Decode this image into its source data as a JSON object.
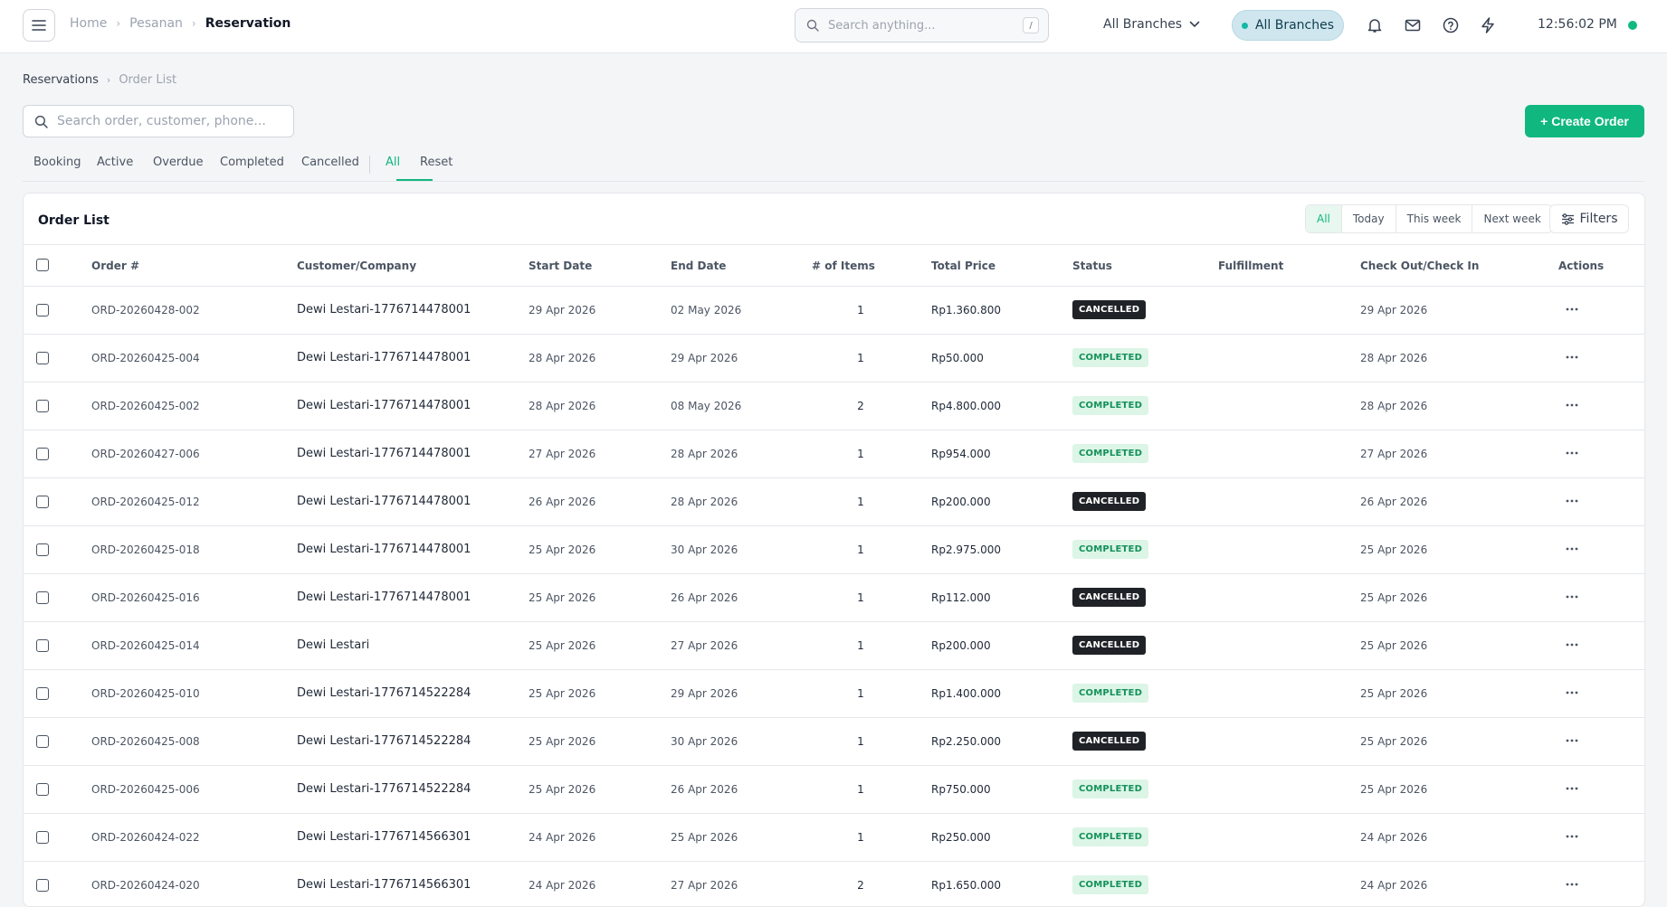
{
  "topbar": {
    "breadcrumb": [
      "Home",
      "Pesanan",
      "Reservation"
    ],
    "search_placeholder": "Search anything...",
    "search_shortcut": "/",
    "branch_select": "All Branches",
    "branch_pill": "All Branches",
    "time": "12:56:02 PM"
  },
  "page": {
    "breadcrumb": [
      "Reservations",
      "Order List"
    ],
    "search_placeholder": "Search order, customer, phone...",
    "create_label": "+ Create Order",
    "tabs": [
      "Booking",
      "Active",
      "Overdue",
      "Completed",
      "Cancelled",
      "All",
      "Reset"
    ],
    "active_tab": "All"
  },
  "card": {
    "title": "Order List",
    "periods": [
      "All",
      "Today",
      "This week",
      "Next week"
    ],
    "active_period": "All",
    "filters_label": "Filters"
  },
  "table": {
    "columns": [
      "Order #",
      "Customer/Company",
      "Start Date",
      "End Date",
      "# of Items",
      "Total Price",
      "Status",
      "Fulfillment",
      "Check Out/Check In",
      "Actions"
    ],
    "rows": [
      {
        "order": "ORD-20260428-002",
        "customer": "Dewi Lestari-1776714478001",
        "start": "29 Apr 2026",
        "end": "02 May 2026",
        "items": "1",
        "price": "Rp1.360.800",
        "status": "CANCELLED",
        "fulfillment": "",
        "checkout": "29 Apr 2026"
      },
      {
        "order": "ORD-20260425-004",
        "customer": "Dewi Lestari-1776714478001",
        "start": "28 Apr 2026",
        "end": "29 Apr 2026",
        "items": "1",
        "price": "Rp50.000",
        "status": "COMPLETED",
        "fulfillment": "",
        "checkout": "28 Apr 2026"
      },
      {
        "order": "ORD-20260425-002",
        "customer": "Dewi Lestari-1776714478001",
        "start": "28 Apr 2026",
        "end": "08 May 2026",
        "items": "2",
        "price": "Rp4.800.000",
        "status": "COMPLETED",
        "fulfillment": "",
        "checkout": "28 Apr 2026"
      },
      {
        "order": "ORD-20260427-006",
        "customer": "Dewi Lestari-1776714478001",
        "start": "27 Apr 2026",
        "end": "28 Apr 2026",
        "items": "1",
        "price": "Rp954.000",
        "status": "COMPLETED",
        "fulfillment": "",
        "checkout": "27 Apr 2026"
      },
      {
        "order": "ORD-20260425-012",
        "customer": "Dewi Lestari-1776714478001",
        "start": "26 Apr 2026",
        "end": "28 Apr 2026",
        "items": "1",
        "price": "Rp200.000",
        "status": "CANCELLED",
        "fulfillment": "",
        "checkout": "26 Apr 2026"
      },
      {
        "order": "ORD-20260425-018",
        "customer": "Dewi Lestari-1776714478001",
        "start": "25 Apr 2026",
        "end": "30 Apr 2026",
        "items": "1",
        "price": "Rp2.975.000",
        "status": "COMPLETED",
        "fulfillment": "",
        "checkout": "25 Apr 2026"
      },
      {
        "order": "ORD-20260425-016",
        "customer": "Dewi Lestari-1776714478001",
        "start": "25 Apr 2026",
        "end": "26 Apr 2026",
        "items": "1",
        "price": "Rp112.000",
        "status": "CANCELLED",
        "fulfillment": "",
        "checkout": "25 Apr 2026"
      },
      {
        "order": "ORD-20260425-014",
        "customer": "Dewi Lestari",
        "start": "25 Apr 2026",
        "end": "27 Apr 2026",
        "items": "1",
        "price": "Rp200.000",
        "status": "CANCELLED",
        "fulfillment": "",
        "checkout": "25 Apr 2026"
      },
      {
        "order": "ORD-20260425-010",
        "customer": "Dewi Lestari-1776714522284",
        "start": "25 Apr 2026",
        "end": "29 Apr 2026",
        "items": "1",
        "price": "Rp1.400.000",
        "status": "COMPLETED",
        "fulfillment": "",
        "checkout": "25 Apr 2026"
      },
      {
        "order": "ORD-20260425-008",
        "customer": "Dewi Lestari-1776714522284",
        "start": "25 Apr 2026",
        "end": "30 Apr 2026",
        "items": "1",
        "price": "Rp2.250.000",
        "status": "CANCELLED",
        "fulfillment": "",
        "checkout": "25 Apr 2026"
      },
      {
        "order": "ORD-20260425-006",
        "customer": "Dewi Lestari-1776714522284",
        "start": "25 Apr 2026",
        "end": "26 Apr 2026",
        "items": "1",
        "price": "Rp750.000",
        "status": "COMPLETED",
        "fulfillment": "",
        "checkout": "25 Apr 2026"
      },
      {
        "order": "ORD-20260424-022",
        "customer": "Dewi Lestari-1776714566301",
        "start": "24 Apr 2026",
        "end": "25 Apr 2026",
        "items": "1",
        "price": "Rp250.000",
        "status": "COMPLETED",
        "fulfillment": "",
        "checkout": "24 Apr 2026"
      },
      {
        "order": "ORD-20260424-020",
        "customer": "Dewi Lestari-1776714566301",
        "start": "24 Apr 2026",
        "end": "27 Apr 2026",
        "items": "2",
        "price": "Rp1.650.000",
        "status": "COMPLETED",
        "fulfillment": "",
        "checkout": "24 Apr 2026"
      }
    ]
  },
  "icons": {
    "menu": "menu-icon",
    "search": "search-icon",
    "chevron": "chevron-down-icon",
    "bell": "bell-icon",
    "mail": "mail-icon",
    "help": "help-circle-icon",
    "bolt": "bolt-icon",
    "filters": "sliders-icon",
    "more": "more-horizontal-icon"
  },
  "colors": {
    "accent": "#10b77f",
    "cancelled": "#1f2328",
    "completed_bg": "#dcf5e6",
    "completed_fg": "#14915a"
  }
}
